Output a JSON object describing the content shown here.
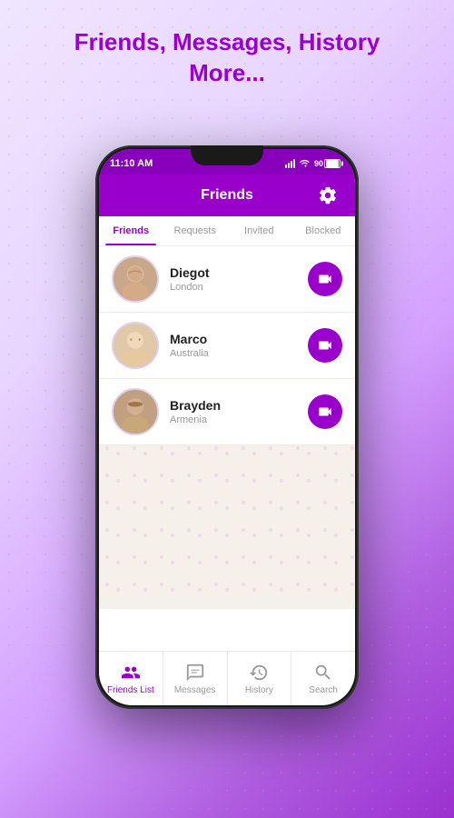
{
  "hero": {
    "title_line1": "Friends, Messages, History",
    "title_line2": "More..."
  },
  "status_bar": {
    "time": "11:10 AM",
    "battery_level": "90"
  },
  "app": {
    "title": "Friends",
    "tabs": [
      {
        "label": "Friends",
        "active": true
      },
      {
        "label": "Requests",
        "active": false
      },
      {
        "label": "Invited",
        "active": false
      },
      {
        "label": "Blocked",
        "active": false
      }
    ]
  },
  "friends": [
    {
      "name": "Diegot",
      "location": "London"
    },
    {
      "name": "Marco",
      "location": "Australia"
    },
    {
      "name": "Brayden",
      "location": "Armenia"
    }
  ],
  "bottom_nav": [
    {
      "label": "Friends List",
      "icon": "friends-icon",
      "active": true
    },
    {
      "label": "Messages",
      "icon": "messages-icon",
      "active": false
    },
    {
      "label": "History",
      "icon": "history-icon",
      "active": false
    },
    {
      "label": "Search",
      "icon": "search-icon",
      "active": false
    }
  ],
  "icons": {
    "gear": "⚙",
    "video": "📹"
  },
  "colors": {
    "primary": "#9900cc",
    "accent": "#8800bb"
  }
}
